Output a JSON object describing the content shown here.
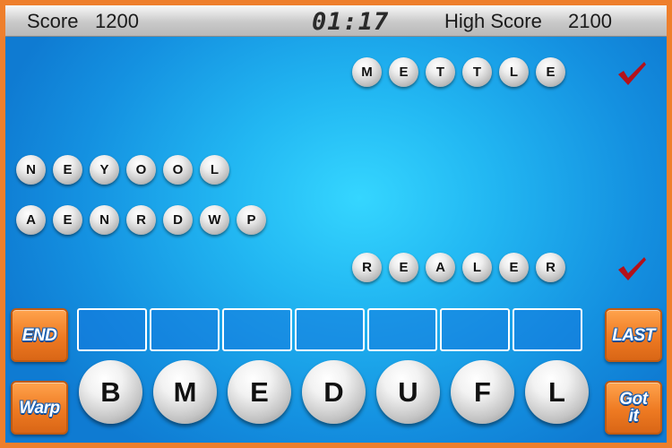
{
  "hud": {
    "score_label": "Score",
    "score_value": "1200",
    "timer": "01:17",
    "high_score_label": "High Score",
    "high_score_value": "2100"
  },
  "words": [
    {
      "letters": [
        "M",
        "E",
        "T",
        "T",
        "L",
        "E"
      ],
      "solved": true
    },
    {
      "letters": [
        "N",
        "E",
        "Y",
        "O",
        "O",
        "L"
      ],
      "solved": false
    },
    {
      "letters": [
        "A",
        "E",
        "N",
        "R",
        "D",
        "W",
        "P"
      ],
      "solved": false
    },
    {
      "letters": [
        "R",
        "E",
        "A",
        "L",
        "E",
        "R"
      ],
      "solved": true
    }
  ],
  "answer_slots": 7,
  "tiles": [
    "B",
    "M",
    "E",
    "D",
    "U",
    "F",
    "L"
  ],
  "buttons": {
    "end": "END",
    "warp": "Warp",
    "last": "LAST",
    "got_it_line1": "Got",
    "got_it_line2": "it"
  },
  "colors": {
    "frame": "#ee7f2c",
    "board": "#1e9fe8",
    "button": "#ee7a22",
    "check": "#b3121b"
  }
}
